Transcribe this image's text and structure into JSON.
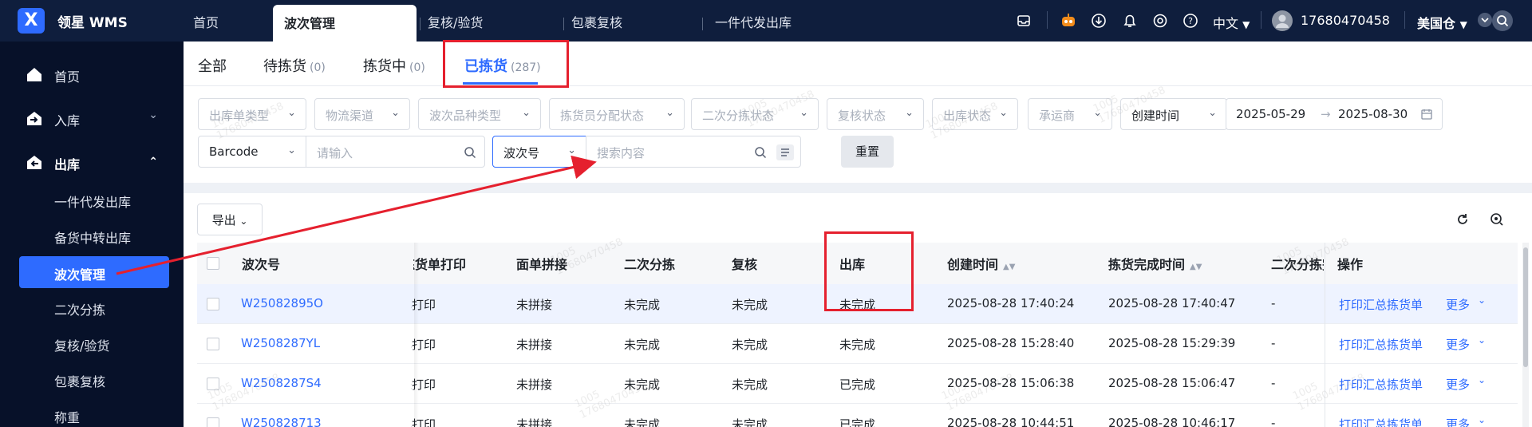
{
  "brand": {
    "name": "领星 WMS"
  },
  "topnav": {
    "tabs": [
      "首页",
      "波次管理",
      "复核/验货",
      "包裹复核",
      "一件代发出库"
    ],
    "language": "中文",
    "user": "17680470458",
    "warehouse": "美国仓"
  },
  "sidebar": {
    "items": [
      {
        "label": "首页"
      },
      {
        "label": "入库"
      },
      {
        "label": "出库"
      }
    ],
    "subitems": [
      "一件代发出库",
      "备货中转出库",
      "波次管理",
      "二次分拣",
      "复核/验货",
      "包裹复核",
      "称重"
    ]
  },
  "subtabs": [
    {
      "label": "全部",
      "count": ""
    },
    {
      "label": "待拣货",
      "count": "(0)"
    },
    {
      "label": "拣货中",
      "count": "(0)"
    },
    {
      "label": "已拣货",
      "count": "(287)"
    }
  ],
  "filters": {
    "row1": [
      "出库单类型",
      "物流渠道",
      "波次品种类型",
      "拣货员分配状态",
      "二次分拣状态",
      "复核状态",
      "出库状态",
      "承运商"
    ],
    "date_type": "创建时间",
    "date_start": "2025-05-29",
    "date_arrow": "→",
    "date_end": "2025-08-30",
    "code_type": "Barcode",
    "code_placeholder": "请输入",
    "search_type": "波次号",
    "search_placeholder": "搜索内容",
    "reset": "重置"
  },
  "table": {
    "export": "导出",
    "headers": [
      "波次号",
      "拣货单打印",
      "面单拼接",
      "二次分拣",
      "复核",
      "出库",
      "创建时间",
      "拣货完成时间",
      "二次分拣完",
      "操作"
    ],
    "rows": [
      [
        "W25082895O",
        "已打印",
        "未拼接",
        "未完成",
        "未完成",
        "未完成",
        "2025-08-28 17:40:24",
        "2025-08-28 17:40:47",
        "-",
        "打印汇总拣货单",
        "更多"
      ],
      [
        "W2508287YL",
        "已打印",
        "未拼接",
        "未完成",
        "未完成",
        "未完成",
        "2025-08-28 15:28:40",
        "2025-08-28 15:29:39",
        "-",
        "打印汇总拣货单",
        "更多"
      ],
      [
        "W2508287S4",
        "未打印",
        "未拼接",
        "未完成",
        "未完成",
        "已完成",
        "2025-08-28 15:06:38",
        "2025-08-28 15:06:47",
        "-",
        "打印汇总拣货单",
        "更多"
      ],
      [
        "W250828713",
        "已打印",
        "未拼接",
        "未完成",
        "未完成",
        "已完成",
        "2025-08-28 10:44:51",
        "2025-08-28 10:46:17",
        "-",
        "打印汇总拣货单",
        "更多"
      ]
    ]
  },
  "watermark": {
    "line1": "1005",
    "line2": "17680470458"
  },
  "colors": {
    "accent": "#2e6bff",
    "sidebar": "#071129",
    "topbar": "#0f1e3d",
    "annotation": "#e5202e"
  }
}
